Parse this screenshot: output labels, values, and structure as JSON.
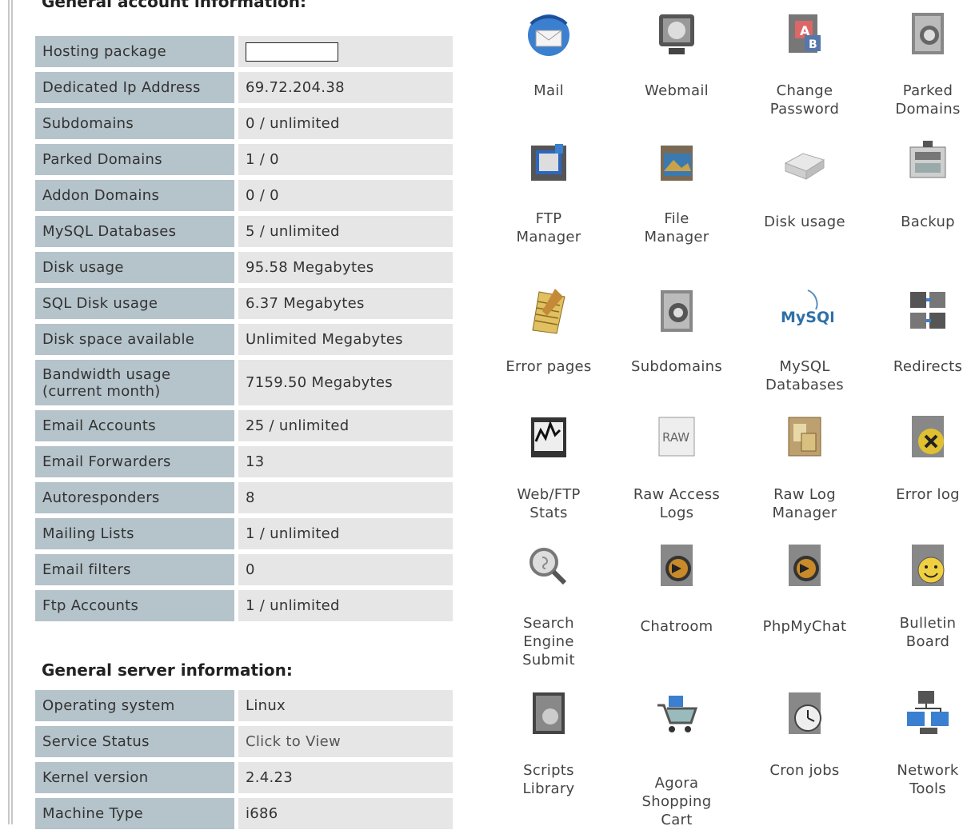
{
  "account": {
    "title": "General account information:",
    "rows": [
      {
        "label": "Hosting package",
        "value": ""
      },
      {
        "label": "Dedicated Ip Address",
        "value": "69.72.204.38"
      },
      {
        "label": "Subdomains",
        "value": "0 / unlimited"
      },
      {
        "label": "Parked Domains",
        "value": "1 / 0"
      },
      {
        "label": "Addon Domains",
        "value": "0 / 0"
      },
      {
        "label": "MySQL Databases",
        "value": "5 / unlimited"
      },
      {
        "label": "Disk usage",
        "value": "95.58 Megabytes"
      },
      {
        "label": "SQL Disk usage",
        "value": "6.37 Megabytes"
      },
      {
        "label": "Disk space available",
        "value": "Unlimited Megabytes"
      },
      {
        "label": "Bandwidth usage (current month)",
        "value": "7159.50 Megabytes"
      },
      {
        "label": "Email Accounts",
        "value": "25 / unlimited"
      },
      {
        "label": "Email Forwarders",
        "value": "13"
      },
      {
        "label": "Autoresponders",
        "value": "8"
      },
      {
        "label": "Mailing Lists",
        "value": "1 / unlimited"
      },
      {
        "label": "Email filters",
        "value": "0"
      },
      {
        "label": "Ftp Accounts",
        "value": "1 / unlimited"
      }
    ]
  },
  "server": {
    "title": "General server information:",
    "rows": [
      {
        "label": "Operating system",
        "value": "Linux"
      },
      {
        "label": "Service Status",
        "value": "Click to View"
      },
      {
        "label": "Kernel version",
        "value": "2.4.23"
      },
      {
        "label": "Machine Type",
        "value": "i686"
      }
    ]
  },
  "tools": [
    {
      "label": [
        "Mail"
      ],
      "icon": "mail-icon"
    },
    {
      "label": [
        "Webmail"
      ],
      "icon": "webmail-icon"
    },
    {
      "label": [
        "Change",
        "Password"
      ],
      "icon": "change-password-icon"
    },
    {
      "label": [
        "Parked",
        "Domains"
      ],
      "icon": "parked-domains-icon"
    },
    {
      "label": [
        "FTP",
        "Manager"
      ],
      "icon": "ftp-manager-icon"
    },
    {
      "label": [
        "File",
        "Manager"
      ],
      "icon": "file-manager-icon"
    },
    {
      "label": [
        "Disk usage"
      ],
      "icon": "disk-usage-icon"
    },
    {
      "label": [
        "Backup"
      ],
      "icon": "backup-icon"
    },
    {
      "label": [
        "Error pages"
      ],
      "icon": "error-pages-icon"
    },
    {
      "label": [
        "Subdomains"
      ],
      "icon": "subdomains-icon"
    },
    {
      "label": [
        "MySQL",
        "Databases"
      ],
      "icon": "mysql-icon",
      "icon_text": "MySQL"
    },
    {
      "label": [
        "Redirects"
      ],
      "icon": "redirects-icon"
    },
    {
      "label": [
        "Web/FTP",
        "Stats"
      ],
      "icon": "stats-icon"
    },
    {
      "label": [
        "Raw Access",
        "Logs"
      ],
      "icon": "raw-logs-icon",
      "icon_text": "RAW"
    },
    {
      "label": [
        "Raw Log",
        "Manager"
      ],
      "icon": "raw-log-manager-icon"
    },
    {
      "label": [
        "Error log"
      ],
      "icon": "error-log-icon"
    },
    {
      "label": [
        "Search",
        "Engine",
        "Submit"
      ],
      "icon": "search-icon"
    },
    {
      "label": [
        "Chatroom"
      ],
      "icon": "chatroom-icon"
    },
    {
      "label": [
        "PhpMyChat"
      ],
      "icon": "phpmychat-icon"
    },
    {
      "label": [
        "Bulletin",
        "Board"
      ],
      "icon": "bulletin-board-icon"
    },
    {
      "label": [
        "Scripts",
        "Library"
      ],
      "icon": "scripts-library-icon"
    },
    {
      "label": [
        "Agora",
        "Shopping",
        "Cart"
      ],
      "icon": "shopping-cart-icon"
    },
    {
      "label": [
        "Cron jobs"
      ],
      "icon": "cron-jobs-icon"
    },
    {
      "label": [
        "Network",
        "Tools"
      ],
      "icon": "network-tools-icon"
    }
  ],
  "colors": {
    "label_bg": "#b5c3cb",
    "value_bg": "#e6e6e6"
  }
}
